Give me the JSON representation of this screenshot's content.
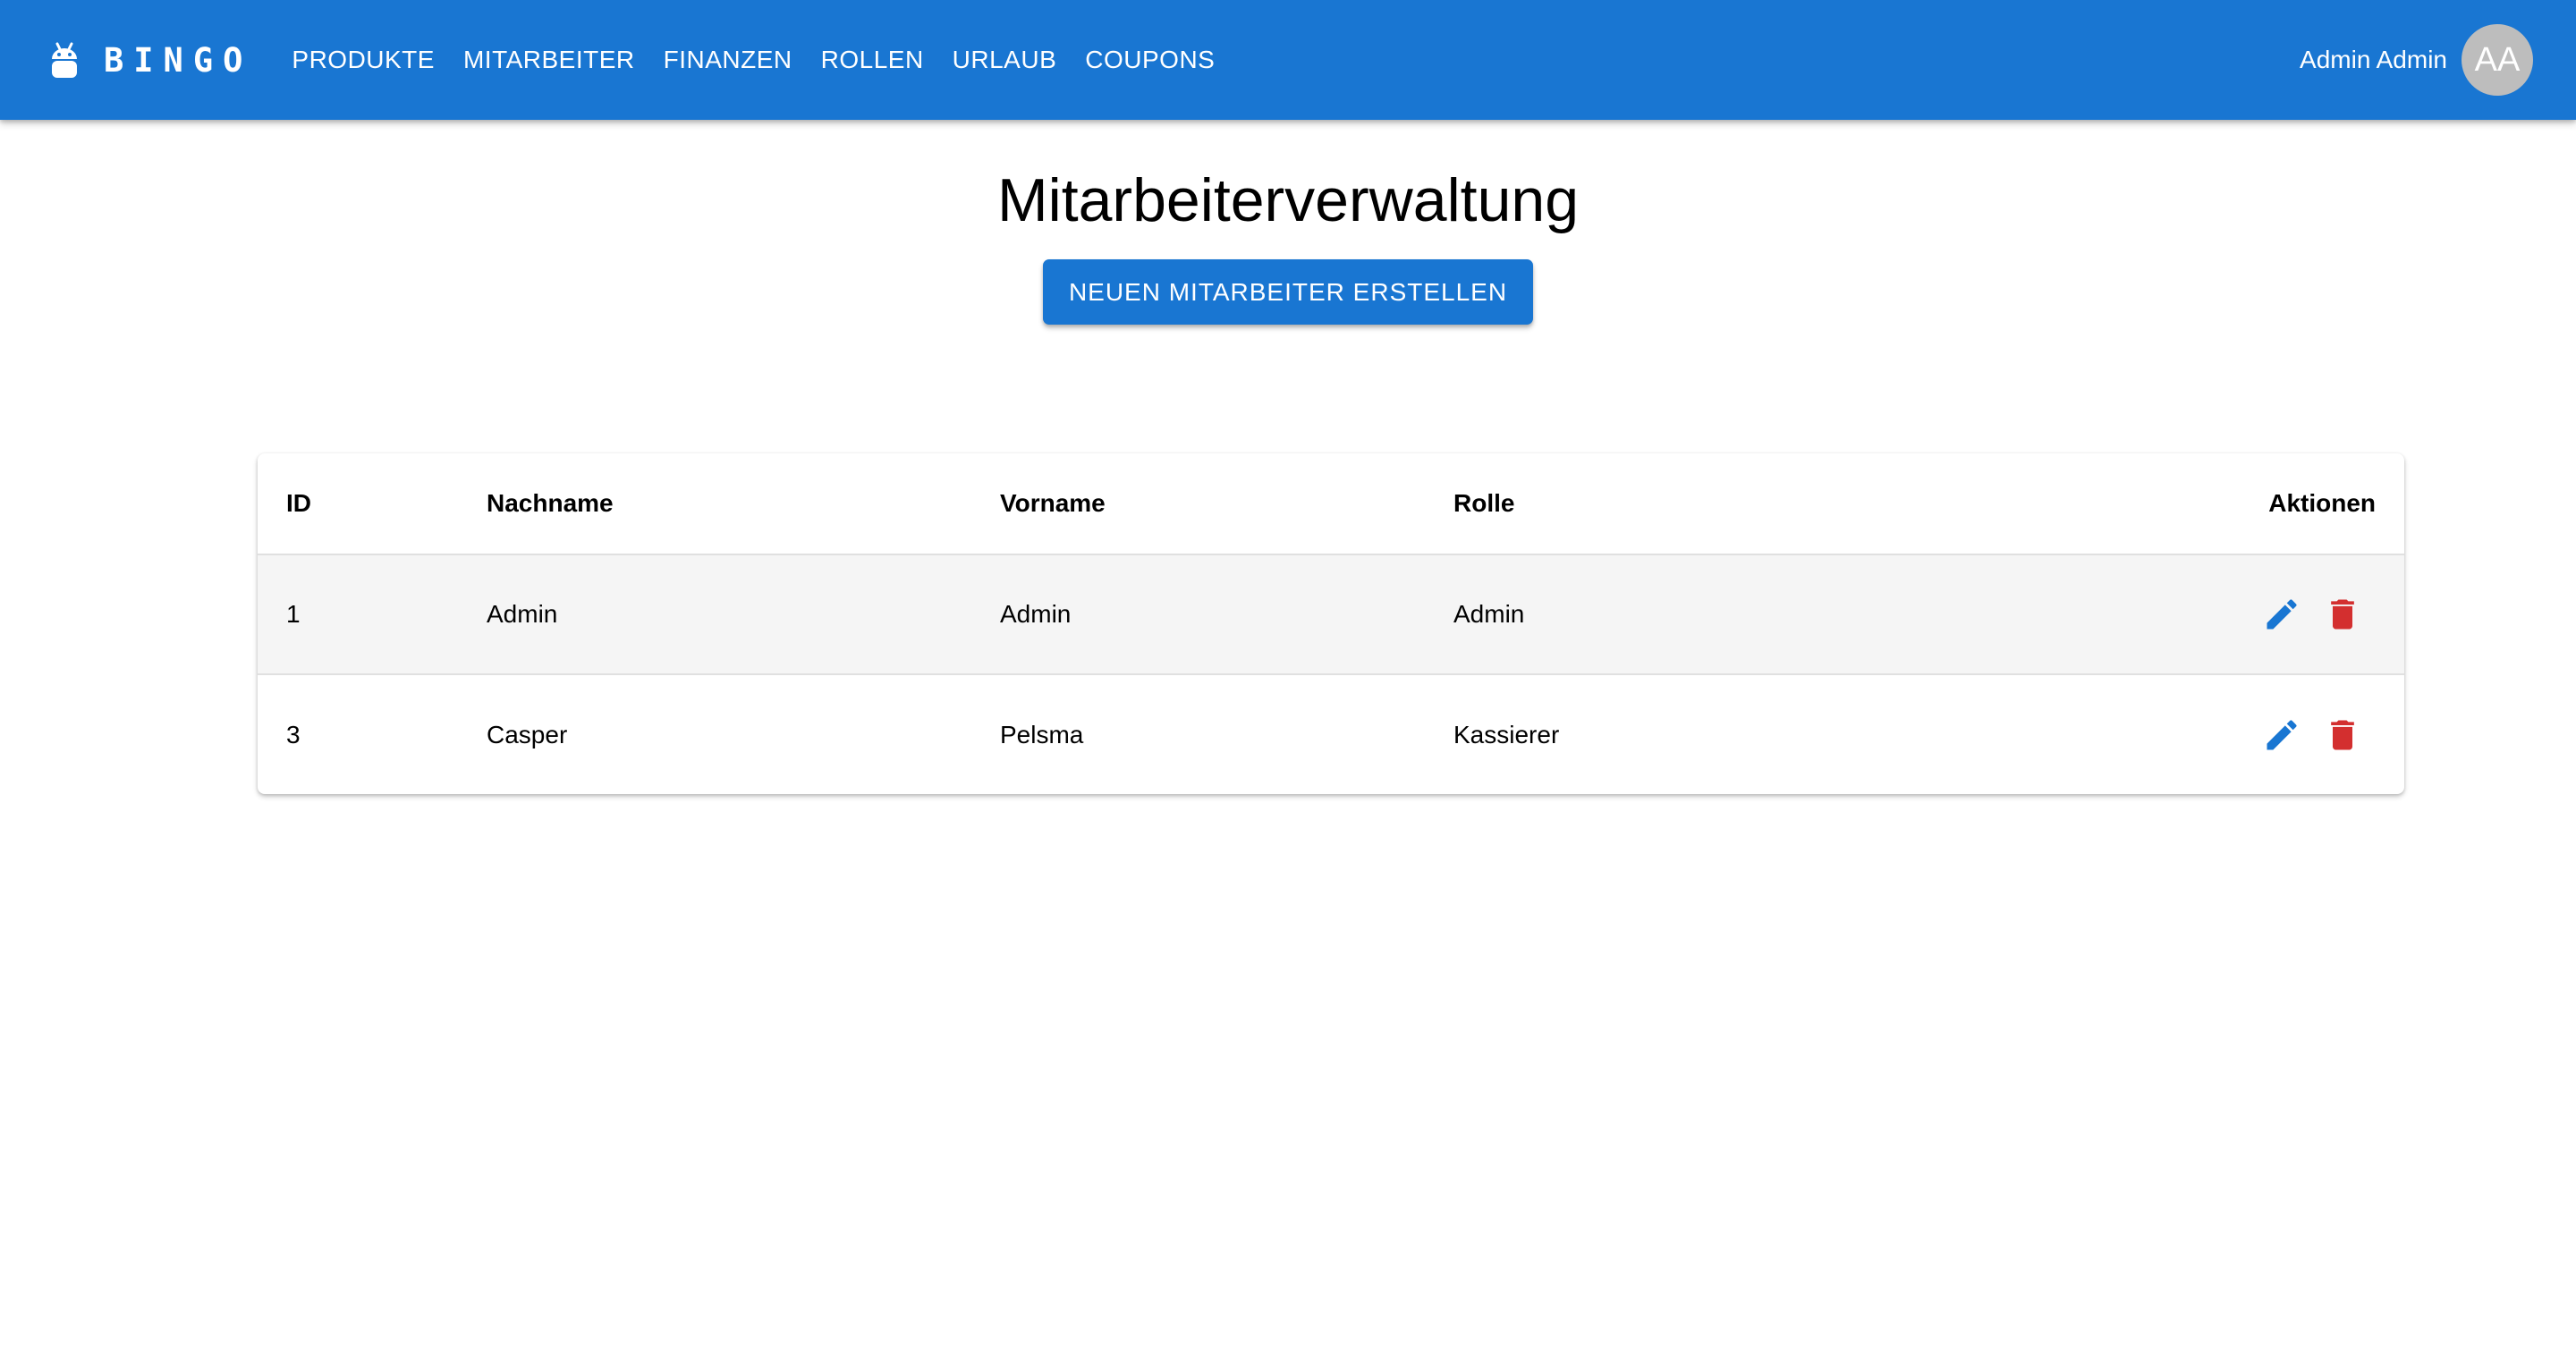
{
  "app": {
    "brand": "BINGO",
    "brand_icon": "android-icon"
  },
  "nav": {
    "items": [
      {
        "label": "PRODUKTE"
      },
      {
        "label": "MITARBEITER"
      },
      {
        "label": "FINANZEN"
      },
      {
        "label": "ROLLEN"
      },
      {
        "label": "URLAUB"
      },
      {
        "label": "COUPONS"
      }
    ]
  },
  "user": {
    "name": "Admin Admin",
    "initials": "AA"
  },
  "page": {
    "title": "Mitarbeiterverwaltung",
    "create_button": "NEUEN MITARBEITER ERSTELLEN"
  },
  "table": {
    "headers": {
      "id": "ID",
      "last_name": "Nachname",
      "first_name": "Vorname",
      "role": "Rolle",
      "actions": "Aktionen"
    },
    "rows": [
      {
        "id": "1",
        "last_name": "Admin",
        "first_name": "Admin",
        "role": "Admin"
      },
      {
        "id": "3",
        "last_name": "Casper",
        "first_name": "Pelsma",
        "role": "Kassierer"
      }
    ],
    "row_actions": [
      "edit-icon",
      "delete-icon"
    ]
  },
  "colors": {
    "primary": "#1976d2",
    "danger": "#d32f2f",
    "avatar": "#bdbdbd",
    "row_shade": "#f5f5f5"
  }
}
